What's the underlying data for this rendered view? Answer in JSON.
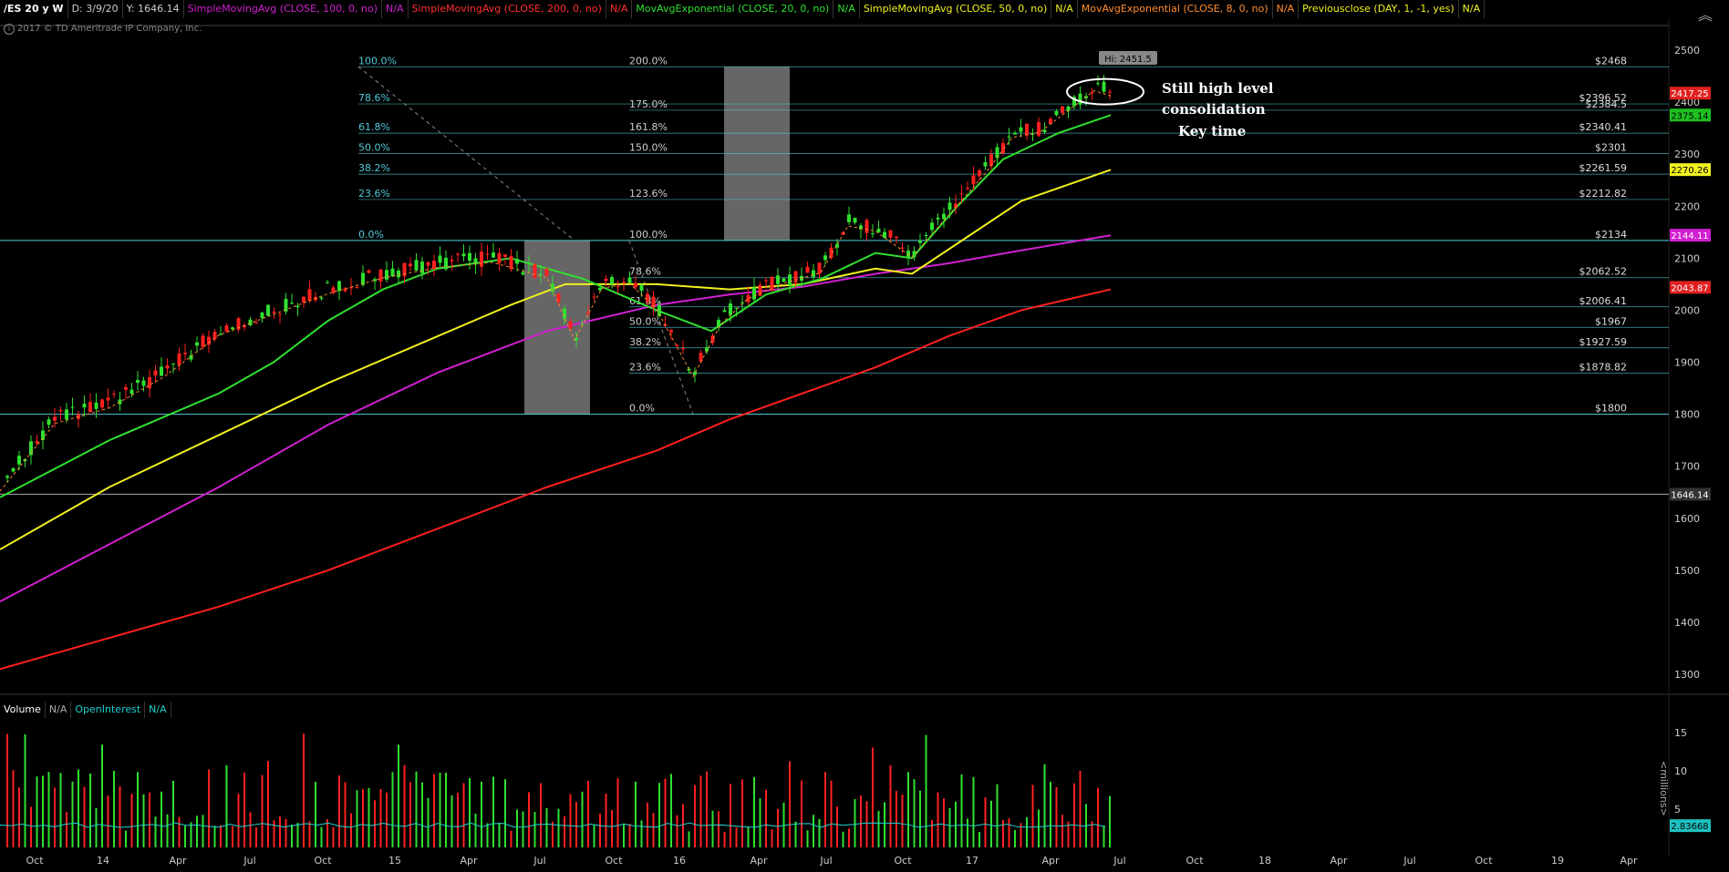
{
  "header": {
    "symbol": "/ES 20 y W",
    "date": "D: 3/9/20",
    "yval": "Y: 1646.14",
    "studies": [
      {
        "label": "SimpleMovingAvg (CLOSE, 100, 0, no)",
        "color": "#d020d0"
      },
      {
        "label": "N/A",
        "color": "#d020d0"
      },
      {
        "label": "SimpleMovingAvg (CLOSE, 200, 0, no)",
        "color": "#ff3030"
      },
      {
        "label": "N/A",
        "color": "#ff3030"
      },
      {
        "label": "MovAvgExponential (CLOSE, 20, 0, no)",
        "color": "#30e030"
      },
      {
        "label": "N/A",
        "color": "#30e030"
      },
      {
        "label": "SimpleMovingAvg (CLOSE, 50, 0, no)",
        "color": "#f0f020"
      },
      {
        "label": "N/A",
        "color": "#f0f020"
      },
      {
        "label": "MovAvgExponential (CLOSE, 8, 0, no)",
        "color": "#ff8c30"
      },
      {
        "label": "N/A",
        "color": "#ff8c30"
      },
      {
        "label": "Previousclose (DAY, 1, -1, yes)",
        "color": "#f0f020"
      },
      {
        "label": "N/A",
        "color": "#f0f020"
      }
    ]
  },
  "copyright": "2017 © TD Ameritrade IP Company, Inc.",
  "notes": [
    "Still high level",
    "consolidation",
    "Key time"
  ],
  "hi_label": "Hi: 2451.5",
  "lower": {
    "volume": "Volume",
    "na1": "N/A",
    "oi": "OpenInterest",
    "na2": "N/A",
    "units": "<millions>"
  },
  "chart_data": {
    "type": "candlestick",
    "price_axis": {
      "ylim": [
        1250,
        2560
      ],
      "ticks": [
        1300,
        1400,
        1500,
        1600,
        1700,
        1800,
        1900,
        2000,
        2100,
        2200,
        2300,
        2400,
        2500
      ]
    },
    "volume_axis": {
      "ylim": [
        0,
        19
      ],
      "ticks": [
        5,
        10,
        15
      ]
    },
    "x_tick_labels": [
      "Oct",
      "14",
      "Apr",
      "Jul",
      "Oct",
      "15",
      "Apr",
      "Jul",
      "Oct",
      "16",
      "Apr",
      "Jul",
      "Oct",
      "17",
      "Apr",
      "Jul",
      "Oct",
      "18",
      "Apr",
      "Jul",
      "Oct",
      "19",
      "Apr"
    ],
    "price_tags": [
      {
        "value": 2417.25,
        "label": "2417.25",
        "bg": "#e02020",
        "fg": "#ffffff"
      },
      {
        "value": 2375.14,
        "label": "2375.14",
        "bg": "#20c020",
        "fg": "#000000"
      },
      {
        "value": 2270.26,
        "label": "2270.26",
        "bg": "#f0f020",
        "fg": "#000000"
      },
      {
        "value": 2144.11,
        "label": "2144.11",
        "bg": "#d020d0",
        "fg": "#ffffff"
      },
      {
        "value": 2043.87,
        "label": "2043.87",
        "bg": "#e02020",
        "fg": "#ffffff"
      },
      {
        "value": 1646.14,
        "label": "1646.14",
        "bg": "#333333",
        "fg": "#ffffff"
      }
    ],
    "volume_tag": {
      "value": 2.83668,
      "label": "2.83668"
    },
    "horizontal_lines": [
      2134,
      1800,
      1646.14
    ],
    "fib_right_levels": [
      {
        "value": 2468,
        "label": "$2468",
        "pct": "200.0%"
      },
      {
        "value": 2396.52,
        "label": "$2396.52",
        "pct": ""
      },
      {
        "value": 2384.5,
        "label": "$2384.5",
        "pct": "175.0%"
      },
      {
        "value": 2340.41,
        "label": "$2340.41",
        "pct": "161.8%"
      },
      {
        "value": 2301,
        "label": "$2301",
        "pct": "150.0%"
      },
      {
        "value": 2261.59,
        "label": "$2261.59",
        "pct": ""
      },
      {
        "value": 2212.82,
        "label": "$2212.82",
        "pct": "123.6%"
      },
      {
        "value": 2134,
        "label": "$2134",
        "pct": "100.0%"
      },
      {
        "value": 2062.52,
        "label": "$2062.52",
        "pct": "78.6%"
      },
      {
        "value": 2006.41,
        "label": "$2006.41",
        "pct": "61.8%"
      },
      {
        "value": 1967,
        "label": "$1967",
        "pct": "50.0%"
      },
      {
        "value": 1927.59,
        "label": "$1927.59",
        "pct": "38.2%"
      },
      {
        "value": 1878.82,
        "label": "$1878.82",
        "pct": "23.6%"
      },
      {
        "value": 1800,
        "label": "$1800",
        "pct": "0.0%"
      }
    ],
    "fib_left_levels": [
      {
        "value": 2468,
        "pct": "100.0%"
      },
      {
        "value": 2396.52,
        "pct": "78.6%"
      },
      {
        "value": 2340.41,
        "pct": "61.8%"
      },
      {
        "value": 2301,
        "pct": "50.0%"
      },
      {
        "value": 2261.59,
        "pct": "38.2%"
      },
      {
        "value": 2212.82,
        "pct": "23.6%"
      },
      {
        "value": 2134,
        "pct": "0.0%"
      }
    ]
  }
}
